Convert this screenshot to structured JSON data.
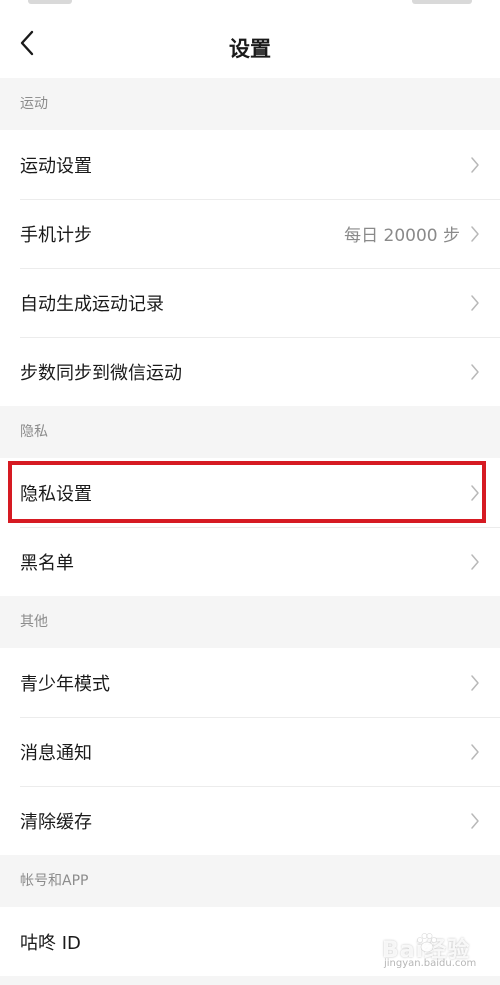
{
  "header": {
    "title": "设置"
  },
  "sections": [
    {
      "title": "运动",
      "items": [
        {
          "label": "运动设置",
          "value": ""
        },
        {
          "label": "手机计步",
          "value": "每日 20000 步"
        },
        {
          "label": "自动生成运动记录",
          "value": ""
        },
        {
          "label": "步数同步到微信运动",
          "value": ""
        }
      ]
    },
    {
      "title": "隐私",
      "items": [
        {
          "label": "隐私设置",
          "value": ""
        },
        {
          "label": "黑名单",
          "value": ""
        }
      ]
    },
    {
      "title": "其他",
      "items": [
        {
          "label": "青少年模式",
          "value": ""
        },
        {
          "label": "消息通知",
          "value": ""
        },
        {
          "label": "清除缓存",
          "value": ""
        }
      ]
    },
    {
      "title": "帐号和APP",
      "items": [
        {
          "label": "咕咚 ID",
          "value": ""
        }
      ]
    }
  ],
  "highlight": {
    "color": "#d61a22"
  },
  "watermark": {
    "text": "Bai经验",
    "url_text": "jingyan.baidu.com"
  },
  "icons": {
    "back": "chevron-left-icon",
    "row_arrow": "chevron-right-icon"
  }
}
